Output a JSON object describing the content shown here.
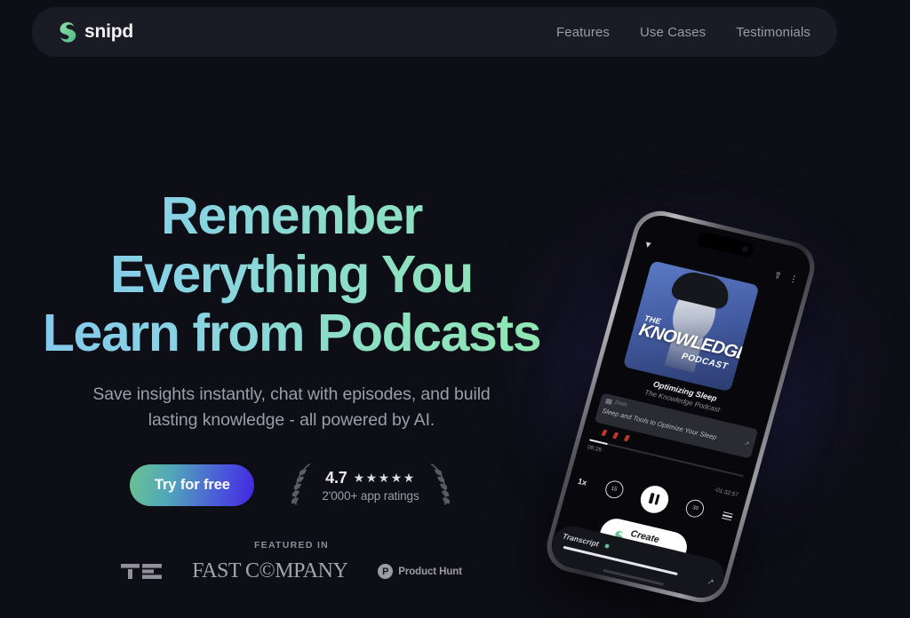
{
  "brand": {
    "name": "snipd",
    "logo_icon": "snipd-leaf-logo"
  },
  "nav": {
    "links": [
      {
        "label": "Features"
      },
      {
        "label": "Use Cases"
      },
      {
        "label": "Testimonials"
      }
    ]
  },
  "hero": {
    "headline": "Remember\nEverything You\nLearn from Podcasts",
    "subheadline": "Save insights instantly, chat with episodes, and build\nlasting knowledge - all powered by AI.",
    "cta_label": "Try for free",
    "rating": {
      "score": "4.7",
      "stars": "★★★★★",
      "caption": "2'000+ app ratings"
    }
  },
  "featured": {
    "label": "FEATURED IN",
    "logos": [
      {
        "name": "techcrunch",
        "text": "TC"
      },
      {
        "name": "fast-company",
        "text": "FAST C©MPANY"
      },
      {
        "name": "product-hunt",
        "badge": "P",
        "text": "Product Hunt"
      }
    ]
  },
  "phone": {
    "artwork": {
      "the": "THE",
      "title": "KNOWLEDGE",
      "kind": "PODCAST"
    },
    "episode_title": "Optimizing Sleep",
    "show_name": "The Knowledge Podcast",
    "snip_card": {
      "duration": "2min",
      "text": "Sleep and Tools to Optimize Your Sleep"
    },
    "player": {
      "elapsed": "08:26",
      "remaining": "-01:32:57",
      "speed": "1x",
      "rewind": "15",
      "forward": "30"
    },
    "create_snip_label": "Create snip",
    "transcript_label": "Transcript"
  },
  "colors": {
    "page_bg": "#0e0e16",
    "nav_bg": "#1b1b25",
    "headline_start": "#84c5f2",
    "headline_end": "#8fe9ad",
    "cta_start": "#6bc292",
    "cta_end": "#4226e3",
    "brand_green": "#6fd39a"
  }
}
